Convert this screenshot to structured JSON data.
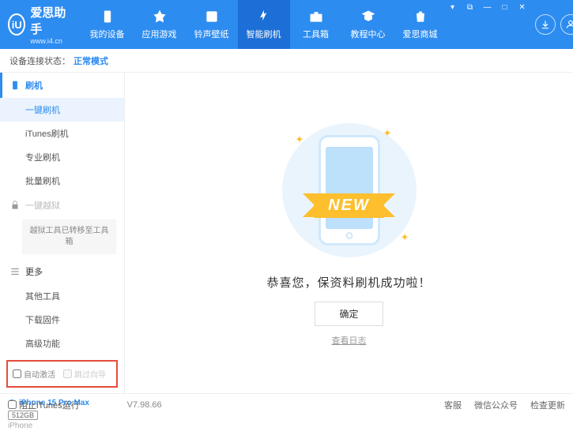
{
  "app": {
    "title": "爱思助手",
    "subtitle": "www.i4.cn",
    "logo_letter": "iU"
  },
  "nav": [
    {
      "label": "我的设备"
    },
    {
      "label": "应用游戏"
    },
    {
      "label": "铃声壁纸"
    },
    {
      "label": "智能刷机"
    },
    {
      "label": "工具箱"
    },
    {
      "label": "教程中心"
    },
    {
      "label": "爱思商城"
    }
  ],
  "status": {
    "label": "设备连接状态：",
    "value": "正常模式"
  },
  "sidebar": {
    "group_flash": "刷机",
    "items_flash": [
      "一键刷机",
      "iTunes刷机",
      "专业刷机",
      "批量刷机"
    ],
    "group_jailbreak": "一键越狱",
    "jailbreak_note": "越狱工具已转移至工具箱",
    "group_more": "更多",
    "items_more": [
      "其他工具",
      "下载固件",
      "高级功能"
    ]
  },
  "checkboxes": {
    "auto_activate": "自动激活",
    "skip_guide": "跳过向导"
  },
  "device": {
    "name": "iPhone 15 Pro Max",
    "storage": "512GB",
    "type": "iPhone"
  },
  "main": {
    "ribbon": "NEW",
    "message": "恭喜您，保资料刷机成功啦！",
    "ok": "确定",
    "log": "查看日志"
  },
  "footer": {
    "block_itunes": "阻止iTunes运行",
    "version": "V7.98.66",
    "links": [
      "客服",
      "微信公众号",
      "检查更新"
    ]
  }
}
